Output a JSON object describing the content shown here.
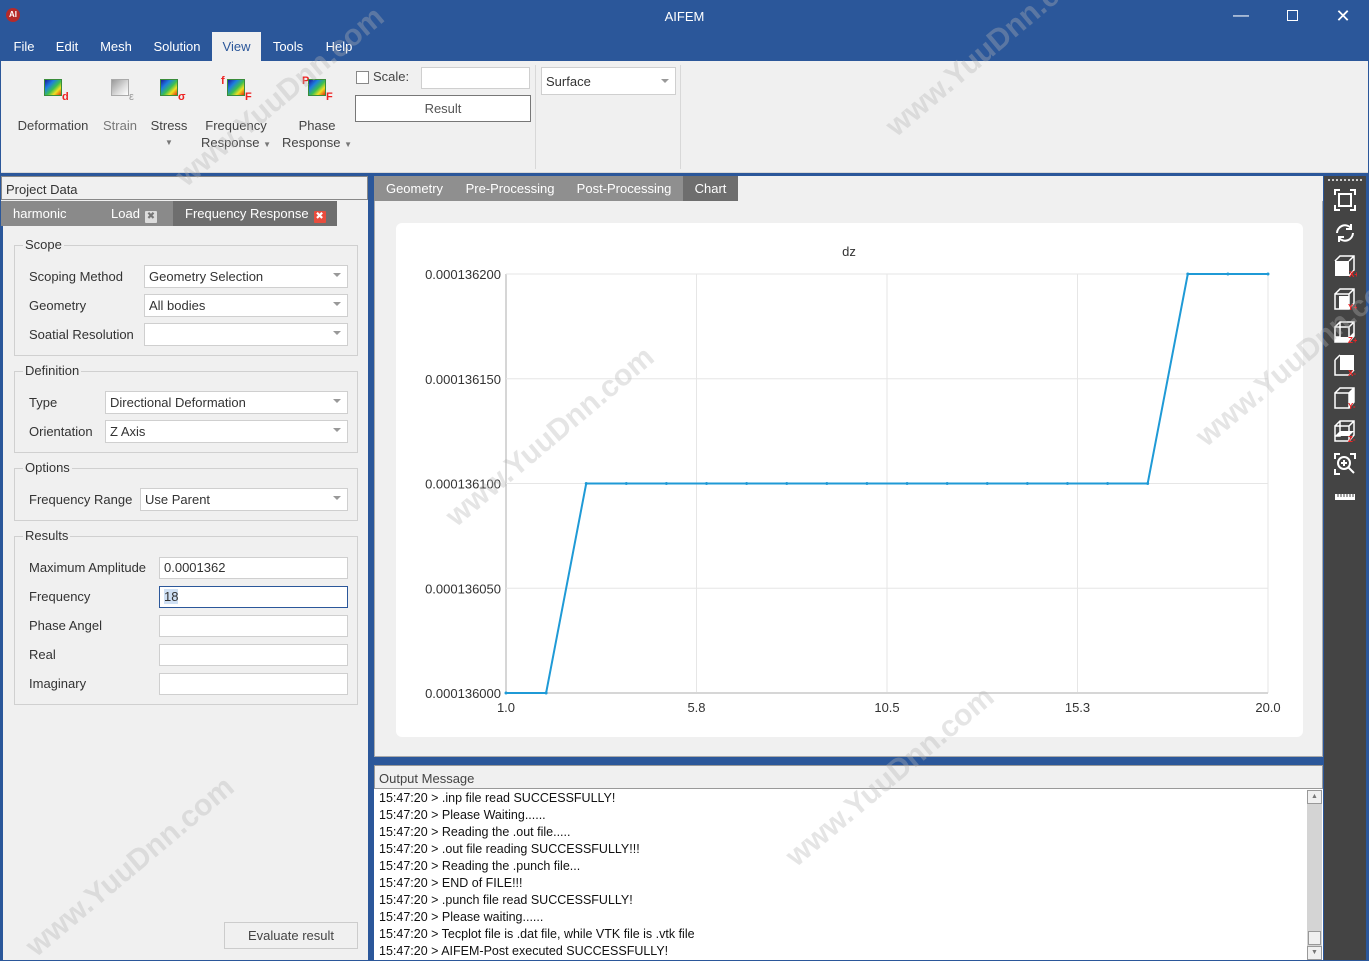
{
  "window": {
    "title": "AIFEM",
    "app_icon": "aifem-logo-icon",
    "controls": [
      "minimize-icon",
      "maximize-icon",
      "close-icon"
    ]
  },
  "menu": {
    "items": [
      "File",
      "Edit",
      "Mesh",
      "Solution",
      "View",
      "Tools",
      "Help"
    ],
    "active": "View"
  },
  "ribbon": {
    "buttons": [
      {
        "label": "Deformation",
        "icon_sub": "d",
        "icon": "deformation-contour-icon"
      },
      {
        "label": "Strain",
        "icon_sub": "ε",
        "icon": "strain-contour-icon",
        "disabled": true
      },
      {
        "label": "Stress",
        "icon_sub": "σ",
        "icon": "stress-contour-icon",
        "has_dropdown": true
      },
      {
        "label_line1": "Frequency",
        "label_line2": "Response",
        "icon_sup": "f",
        "icon_sub": "F",
        "icon": "frequency-response-icon",
        "has_dropdown": true
      },
      {
        "label_line1": "Phase",
        "label_line2": "Response",
        "icon_sup": "P",
        "icon_sub": "F",
        "icon": "phase-response-icon",
        "has_dropdown": true
      }
    ],
    "scale_label": "Scale:",
    "scale_checked": false,
    "scale_value": "",
    "result_button": "Result",
    "display_combo": "Surface"
  },
  "project_panel": {
    "header": "Project Data",
    "tabs": [
      {
        "label": "harmonic",
        "closable": false
      },
      {
        "label": "Load",
        "closable": true
      },
      {
        "label": "Frequency Response",
        "closable": true,
        "active": true
      }
    ],
    "scope": {
      "title": "Scope",
      "scoping_method_label": "Scoping Method",
      "scoping_method_value": "Geometry Selection",
      "geometry_label": "Geometry",
      "geometry_value": "All bodies",
      "spatial_resolution_label": "Soatial Resolution",
      "spatial_resolution_value": ""
    },
    "definition": {
      "title": "Definition",
      "type_label": "Type",
      "type_value": "Directional Deformation",
      "orientation_label": "Orientation",
      "orientation_value": "Z Axis"
    },
    "options": {
      "title": "Options",
      "frequency_range_label": "Frequency Range",
      "frequency_range_value": "Use Parent"
    },
    "results": {
      "title": "Results",
      "max_amplitude_label": "Maximum Amplitude",
      "max_amplitude_value": "0.0001362",
      "frequency_label": "Frequency",
      "frequency_value": "18",
      "phase_angle_label": "Phase Angel",
      "phase_angle_value": "",
      "real_label": "Real",
      "real_value": "",
      "imaginary_label": "Imaginary",
      "imaginary_value": ""
    },
    "evaluate_button": "Evaluate result"
  },
  "center_tabs": {
    "items": [
      "Geometry",
      "Pre-Processing",
      "Post-Processing",
      "Chart"
    ],
    "active": "Chart"
  },
  "chart_data": {
    "type": "line",
    "title": "dz",
    "xlabel": "",
    "ylabel": "",
    "x": [
      1,
      2,
      3,
      4,
      5,
      6,
      7,
      8,
      9,
      10,
      11,
      12,
      13,
      14,
      15,
      16,
      17,
      18,
      19,
      20
    ],
    "series": [
      {
        "name": "dz",
        "color": "#1f9ad6",
        "values": [
          0.000136,
          0.000136,
          0.0001361,
          0.0001361,
          0.0001361,
          0.0001361,
          0.0001361,
          0.0001361,
          0.0001361,
          0.0001361,
          0.0001361,
          0.0001361,
          0.0001361,
          0.0001361,
          0.0001361,
          0.0001361,
          0.0001361,
          0.0001362,
          0.0001362,
          0.0001362
        ]
      }
    ],
    "xlim": [
      1.0,
      20.0
    ],
    "ylim": [
      0.000136,
      0.0001362
    ],
    "xticks": [
      "1.0",
      "5.8",
      "10.5",
      "15.3",
      "20.0"
    ],
    "xtick_values": [
      1.0,
      5.75,
      10.5,
      15.25,
      20.0
    ],
    "yticks": [
      "0.000136000",
      "0.000136050",
      "0.000136100",
      "0.000136150",
      "0.000136200"
    ],
    "ytick_values": [
      0.000136,
      0.00013605,
      0.0001361,
      0.00013615,
      0.0001362
    ],
    "grid": true,
    "legend": "none"
  },
  "output": {
    "header": "Output Message",
    "lines": [
      "15:47:20 > .inp file read SUCCESSFULLY!",
      "15:47:20 > Please Waiting......",
      "15:47:20 > Reading the .out file.....",
      "15:47:20 > .out file reading SUCCESSFULLY!!!",
      "15:47:20 > Reading the .punch file...",
      "15:47:20 > END of FILE!!!",
      "15:47:20 > .punch file read SUCCESSFULLY!",
      "15:47:20 > Please waiting......",
      "15:47:20 > Tecplot file is .dat file, while VTK file is .vtk file",
      "15:47:20 > AIFEM-Post executed SUCCESSFULLY!"
    ]
  },
  "right_toolbar": {
    "buttons": [
      "fit-view-icon",
      "rotate-icon",
      "view-x-plus-icon",
      "view-y-plus-icon",
      "view-z-plus-icon",
      "view-x-minus-icon",
      "view-y-minus-icon",
      "view-z-minus-icon",
      "zoom-box-icon",
      "ruler-icon"
    ]
  },
  "watermark": "www.YuuDnn.com"
}
